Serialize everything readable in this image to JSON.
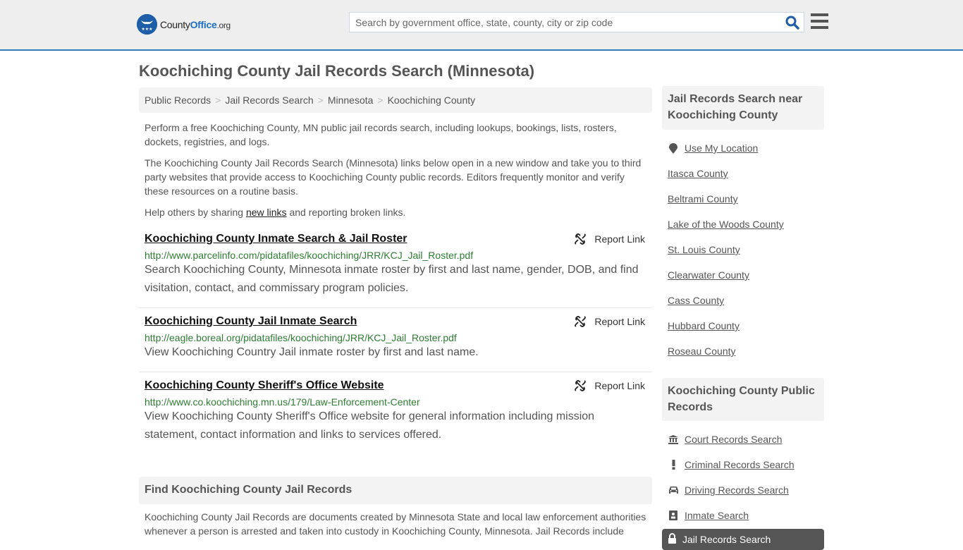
{
  "header": {
    "logo": {
      "brand_prefix": "County",
      "brand_main": "Office",
      "brand_tld": ".org",
      "stars": "★★★"
    },
    "search": {
      "placeholder": "Search by government office, state, county, city or zip code",
      "value": ""
    },
    "icons": {
      "search": "search-icon",
      "menu": "hamburger-menu-icon"
    }
  },
  "page": {
    "title": "Koochiching County Jail Records Search (Minnesota)"
  },
  "breadcrumb": {
    "items": [
      "Public Records",
      "Jail Records Search",
      "Minnesota",
      "Koochiching County"
    ],
    "separator": ">"
  },
  "intro": {
    "p1": "Perform a free Koochiching County, MN public jail records search, including lookups, bookings, lists, rosters, dockets, registries, and logs.",
    "p2": "The Koochiching County Jail Records Search (Minnesota) links below open in a new window and take you to third party websites that provide access to Koochiching County public records. Editors frequently monitor and verify these resources on a routine basis.",
    "p3_before": "Help others by sharing ",
    "p3_link": "new links",
    "p3_after": " and reporting broken links."
  },
  "results": [
    {
      "title": "Koochiching County Inmate Search & Jail Roster",
      "url": "http://www.parcelinfo.com/pidatafiles/koochiching/JRR/KCJ_Jail_Roster.pdf",
      "description": "Search Koochiching County, Minnesota inmate roster by first and last name, gender, DOB, and find visitation, contact, and commissary program policies.",
      "report_label": "Report Link"
    },
    {
      "title": "Koochiching County Jail Inmate Search",
      "url": "http://eagle.boreal.org/pidatafiles/koochiching/JRR/KCJ_Jail_Roster.pdf",
      "description": "View Koochiching Country Jail inmate roster by first and last name.",
      "report_label": "Report Link"
    },
    {
      "title": "Koochiching County Sheriff's Office Website",
      "url": "http://www.co.koochiching.mn.us/179/Law-Enforcement-Center",
      "description": "View Koochiching County Sheriff's Office website for general information including mission statement, contact information and links to services offered.",
      "report_label": "Report Link"
    }
  ],
  "find_section": {
    "heading": "Find Koochiching County Jail Records",
    "text": "Koochiching County Jail Records are documents created by Minnesota State and local law enforcement authorities whenever a person is arrested and taken into custody in Koochiching County, Minnesota. Jail Records include"
  },
  "sidebar": {
    "nearby": {
      "heading": "Jail Records Search near Koochiching County",
      "use_location": "Use My Location",
      "counties": [
        "Itasca County",
        "Beltrami County",
        "Lake of the Woods County",
        "St. Louis County",
        "Clearwater County",
        "Cass County",
        "Hubbard County",
        "Roseau County"
      ]
    },
    "public_records": {
      "heading": "Koochiching County Public Records",
      "items": [
        {
          "label": "Court Records Search",
          "icon": "courthouse-icon"
        },
        {
          "label": "Criminal Records Search",
          "icon": "exclamation-icon"
        },
        {
          "label": "Driving Records Search",
          "icon": "car-icon"
        },
        {
          "label": "Inmate Search",
          "icon": "id-badge-icon"
        }
      ],
      "active": {
        "label": "Jail Records Search",
        "icon": "lock-icon"
      }
    }
  },
  "colors": {
    "accent": "#337ab7",
    "url_green": "#2e7d32",
    "header_bg": "#eeeeee",
    "active_bg": "#555555"
  }
}
